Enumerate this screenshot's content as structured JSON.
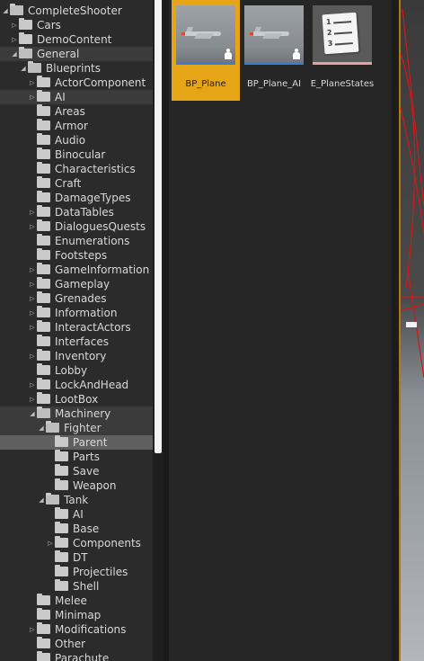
{
  "folder_tree": {
    "items": [
      {
        "label": "CompleteShooter",
        "indent": 1,
        "state": "expanded"
      },
      {
        "label": "Cars",
        "indent": 2,
        "state": "collapsed"
      },
      {
        "label": "DemoContent",
        "indent": 2,
        "state": "collapsed"
      },
      {
        "label": "General",
        "indent": 2,
        "state": "expanded",
        "highlight": true
      },
      {
        "label": "Blueprints",
        "indent": 3,
        "state": "expanded"
      },
      {
        "label": "ActorComponent",
        "indent": 4,
        "state": "collapsed"
      },
      {
        "label": "AI",
        "indent": 4,
        "state": "collapsed",
        "highlight": true
      },
      {
        "label": "Areas",
        "indent": 4,
        "state": "leaf"
      },
      {
        "label": "Armor",
        "indent": 4,
        "state": "leaf"
      },
      {
        "label": "Audio",
        "indent": 4,
        "state": "leaf"
      },
      {
        "label": "Binocular",
        "indent": 4,
        "state": "leaf"
      },
      {
        "label": "Characteristics",
        "indent": 4,
        "state": "leaf"
      },
      {
        "label": "Craft",
        "indent": 4,
        "state": "leaf"
      },
      {
        "label": "DamageTypes",
        "indent": 4,
        "state": "leaf"
      },
      {
        "label": "DataTables",
        "indent": 4,
        "state": "collapsed"
      },
      {
        "label": "DialoguesQuests",
        "indent": 4,
        "state": "collapsed"
      },
      {
        "label": "Enumerations",
        "indent": 4,
        "state": "leaf"
      },
      {
        "label": "Footsteps",
        "indent": 4,
        "state": "leaf"
      },
      {
        "label": "GameInformation",
        "indent": 4,
        "state": "collapsed"
      },
      {
        "label": "Gameplay",
        "indent": 4,
        "state": "collapsed"
      },
      {
        "label": "Grenades",
        "indent": 4,
        "state": "collapsed"
      },
      {
        "label": "Information",
        "indent": 4,
        "state": "collapsed"
      },
      {
        "label": "InteractActors",
        "indent": 4,
        "state": "collapsed"
      },
      {
        "label": "Interfaces",
        "indent": 4,
        "state": "leaf"
      },
      {
        "label": "Inventory",
        "indent": 4,
        "state": "collapsed"
      },
      {
        "label": "Lobby",
        "indent": 4,
        "state": "leaf"
      },
      {
        "label": "LockAndHead",
        "indent": 4,
        "state": "collapsed"
      },
      {
        "label": "LootBox",
        "indent": 4,
        "state": "collapsed"
      },
      {
        "label": "Machinery",
        "indent": 4,
        "state": "expanded",
        "highlight": true
      },
      {
        "label": "Fighter",
        "indent": 5,
        "state": "expanded",
        "highlight": true
      },
      {
        "label": "Parent",
        "indent": 6,
        "state": "leaf",
        "selected": true
      },
      {
        "label": "Parts",
        "indent": 6,
        "state": "leaf"
      },
      {
        "label": "Save",
        "indent": 6,
        "state": "leaf"
      },
      {
        "label": "Weapon",
        "indent": 6,
        "state": "leaf"
      },
      {
        "label": "Tank",
        "indent": 5,
        "state": "expanded"
      },
      {
        "label": "AI",
        "indent": 6,
        "state": "leaf"
      },
      {
        "label": "Base",
        "indent": 6,
        "state": "leaf"
      },
      {
        "label": "Components",
        "indent": 6,
        "state": "collapsed"
      },
      {
        "label": "DT",
        "indent": 6,
        "state": "leaf"
      },
      {
        "label": "Projectiles",
        "indent": 6,
        "state": "leaf"
      },
      {
        "label": "Shell",
        "indent": 6,
        "state": "leaf"
      },
      {
        "label": "Melee",
        "indent": 4,
        "state": "leaf"
      },
      {
        "label": "Minimap",
        "indent": 4,
        "state": "leaf"
      },
      {
        "label": "Modifications",
        "indent": 4,
        "state": "collapsed"
      },
      {
        "label": "Other",
        "indent": 4,
        "state": "leaf"
      },
      {
        "label": "Parachute",
        "indent": 4,
        "state": "leaf"
      }
    ]
  },
  "assets": [
    {
      "label": "BP_Plane",
      "kind": "blueprint-pawn",
      "selected": true,
      "stripe_color": "#3a7bd5"
    },
    {
      "label": "BP_Plane_AI",
      "kind": "blueprint-pawn",
      "selected": false,
      "stripe_color": "#3a7bd5"
    },
    {
      "label": "E_PlaneStates",
      "kind": "enumeration",
      "selected": false,
      "stripe_color": "#e6a0a0"
    }
  ],
  "colors": {
    "selection_accent": "#e6a417",
    "tree_selected": "#5f5f5f",
    "viewport_wire": "#d11818"
  }
}
